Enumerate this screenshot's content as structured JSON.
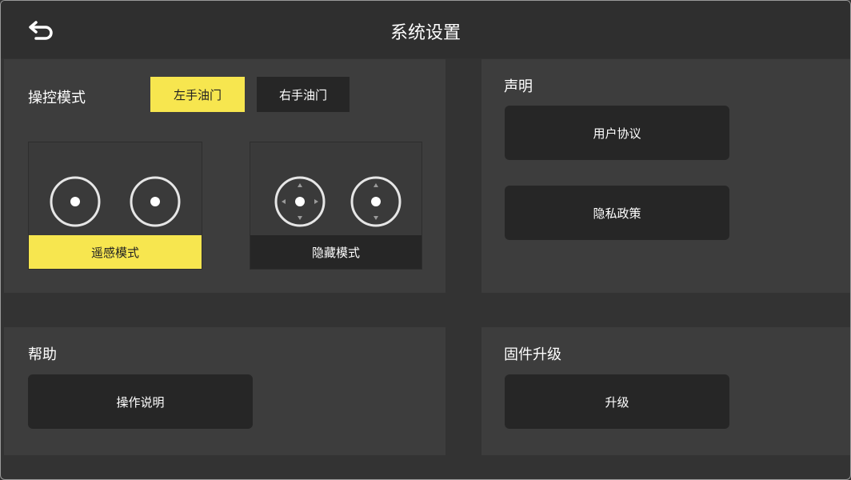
{
  "header": {
    "title": "系统设置",
    "back_icon": "back-arrow-icon"
  },
  "control_mode": {
    "title": "操控模式",
    "left_throttle_label": "左手油门",
    "right_throttle_label": "右手油门",
    "selected_throttle": "左手油门",
    "joystick_mode_label": "遥感模式",
    "hidden_mode_label": "隐藏模式",
    "selected_mode": "遥感模式"
  },
  "statement": {
    "title": "声明",
    "user_agreement_label": "用户协议",
    "privacy_policy_label": "隐私政策"
  },
  "help": {
    "title": "帮助",
    "instructions_label": "操作说明"
  },
  "firmware": {
    "title": "固件升级",
    "upgrade_label": "升级"
  },
  "colors": {
    "accent": "#f7e64f",
    "background": "#333333",
    "panel": "#3d3d3d",
    "button": "#262626"
  }
}
